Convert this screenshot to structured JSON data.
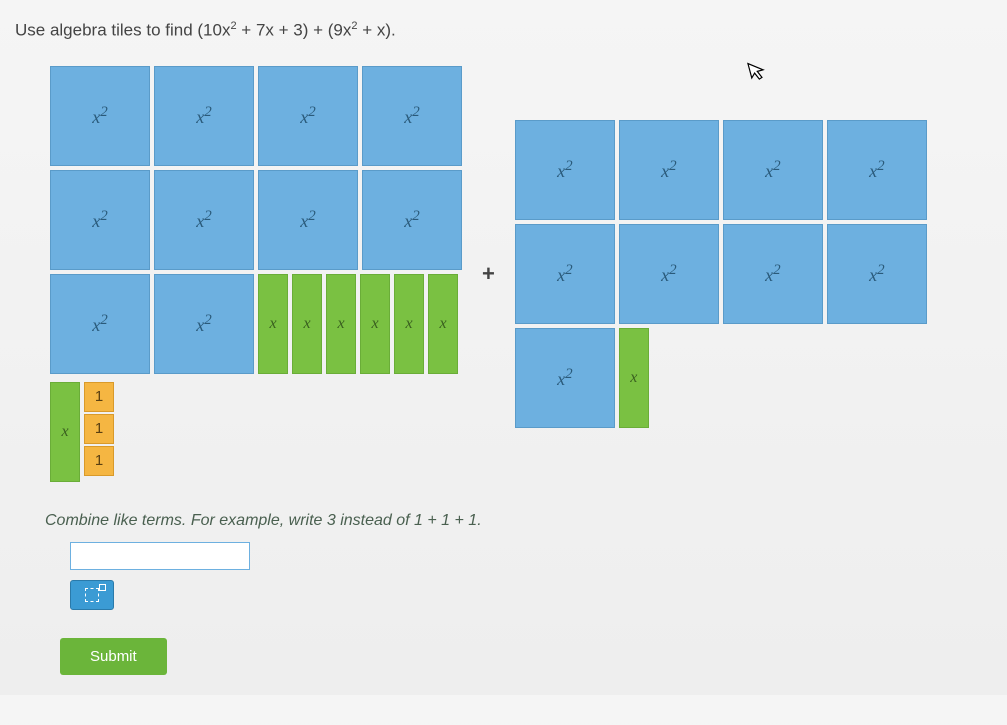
{
  "question_prefix": "Use algebra tiles to find (10x",
  "question_mid1": " + 7x + 3) + (9x",
  "question_mid2": " + x).",
  "sup2": "2",
  "tiles": {
    "x2_label_base": "x",
    "x2_label_exp": "2",
    "x_label": "x",
    "one_label": "1"
  },
  "plus": "+",
  "instruction": "Combine like terms. For example, write 3 instead of 1 + 1 + 1.",
  "answer_value": "",
  "submit_label": "Submit"
}
